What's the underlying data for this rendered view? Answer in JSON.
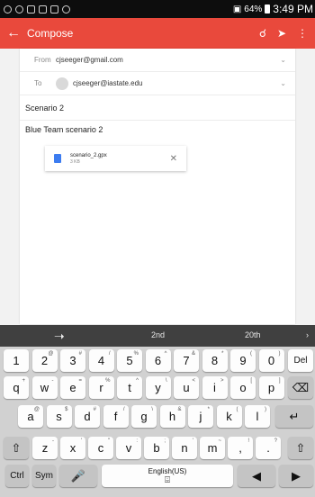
{
  "status": {
    "battery": "64%",
    "time": "3:49 PM"
  },
  "appbar": {
    "title": "Compose"
  },
  "compose": {
    "from_label": "From",
    "from_value": "cjseeger@gmail.com",
    "to_label": "To",
    "to_value": "cjseeger@iastate.edu",
    "subject": "Scenario 2",
    "body": "Blue Team scenario 2",
    "attachment": {
      "name": "scenario_2.gpx",
      "size": "3 KB"
    }
  },
  "keyboard": {
    "suggestions": [
      "2nd",
      "20th"
    ],
    "row1": [
      {
        "k": "1",
        "s": ""
      },
      {
        "k": "2",
        "s": "@"
      },
      {
        "k": "3",
        "s": "#"
      },
      {
        "k": "4",
        "s": "/"
      },
      {
        "k": "5",
        "s": "%"
      },
      {
        "k": "6",
        "s": "^"
      },
      {
        "k": "7",
        "s": "&"
      },
      {
        "k": "8",
        "s": "*"
      },
      {
        "k": "9",
        "s": "("
      },
      {
        "k": "0",
        "s": ")"
      }
    ],
    "del": "Del",
    "row2": [
      {
        "k": "q",
        "s": "+"
      },
      {
        "k": "w",
        "s": "-"
      },
      {
        "k": "e",
        "s": "="
      },
      {
        "k": "r",
        "s": "%"
      },
      {
        "k": "t",
        "s": "^"
      },
      {
        "k": "y",
        "s": "\\"
      },
      {
        "k": "u",
        "s": "<"
      },
      {
        "k": "i",
        "s": ">"
      },
      {
        "k": "o",
        "s": "["
      },
      {
        "k": "p",
        "s": "]"
      }
    ],
    "row3": [
      {
        "k": "a",
        "s": "@"
      },
      {
        "k": "s",
        "s": "$"
      },
      {
        "k": "d",
        "s": "#"
      },
      {
        "k": "f",
        "s": "/"
      },
      {
        "k": "g",
        "s": "\\"
      },
      {
        "k": "h",
        "s": "&"
      },
      {
        "k": "j",
        "s": "*"
      },
      {
        "k": "k",
        "s": "("
      },
      {
        "k": "l",
        "s": ")"
      }
    ],
    "row4": [
      {
        "k": "z",
        "s": "-"
      },
      {
        "k": "x",
        "s": "'"
      },
      {
        "k": "c",
        "s": "\""
      },
      {
        "k": "v",
        "s": ":"
      },
      {
        "k": "b",
        "s": ";"
      },
      {
        "k": "n",
        "s": "'"
      },
      {
        "k": "m",
        "s": "~"
      },
      {
        "k": ",",
        "s": "!"
      },
      {
        "k": ".",
        "s": "?"
      }
    ],
    "ctrl": "Ctrl",
    "sym": "Sym",
    "language": "English(US)"
  }
}
